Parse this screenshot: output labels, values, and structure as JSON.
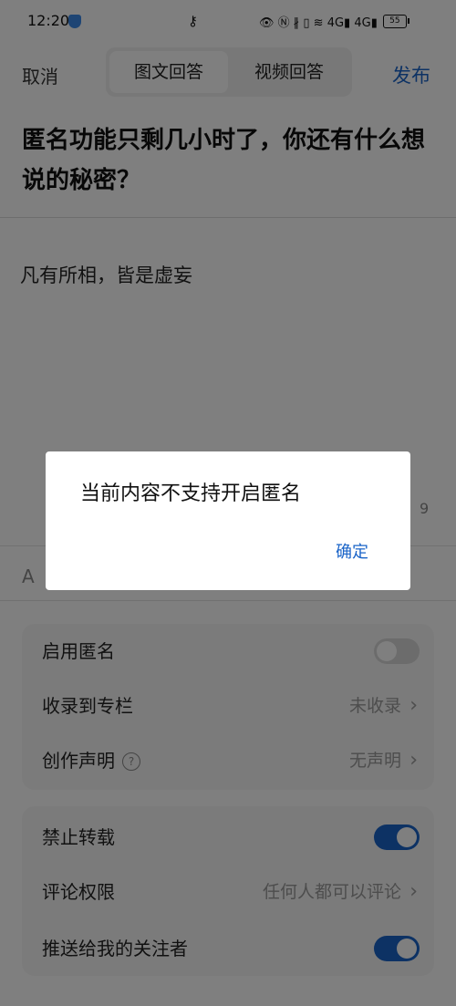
{
  "status_bar": {
    "time": "12:20",
    "battery": "55",
    "right_icons": "👁 Ⓝ ∦ ▯ ≋ 4G▮ 4G▮"
  },
  "nav": {
    "cancel": "取消",
    "tabs": [
      {
        "label": "图文回答",
        "active": true
      },
      {
        "label": "视频回答",
        "active": false
      }
    ],
    "publish": "发布"
  },
  "question": "匿名功能只剩几小时了，你还有什么想说的秘密？",
  "answer_text": "凡有所相，皆是虚妄",
  "char_count": "9",
  "tag_prefix": "A",
  "settings_group1": [
    {
      "label": "启用匿名",
      "type": "toggle",
      "on": false
    },
    {
      "label": "收录到专栏",
      "type": "link",
      "value": "未收录"
    },
    {
      "label": "创作声明",
      "type": "link",
      "value": "无声明",
      "help": "?"
    }
  ],
  "settings_group2": [
    {
      "label": "禁止转载",
      "type": "toggle",
      "on": true
    },
    {
      "label": "评论权限",
      "type": "link",
      "value": "任何人都可以评论"
    },
    {
      "label": "推送给我的关注者",
      "type": "toggle",
      "on": true
    }
  ],
  "dialog": {
    "message": "当前内容不支持开启匿名",
    "confirm": "确定"
  },
  "colors": {
    "accent": "#1a64c8",
    "overlay": "rgba(0,0,0,0.5)"
  }
}
